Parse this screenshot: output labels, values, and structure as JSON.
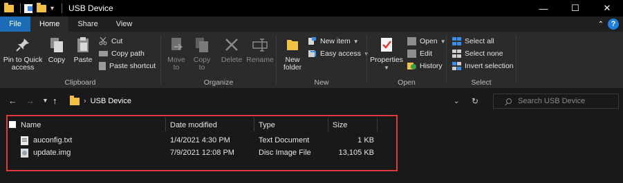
{
  "window": {
    "title": "USB Device",
    "minimize_glyph": "—",
    "maximize_glyph": "☐",
    "close_glyph": "✕"
  },
  "ribbon_tabs": {
    "file": "File",
    "home": "Home",
    "share": "Share",
    "view": "View"
  },
  "clipboard": {
    "pin": "Pin to Quick access",
    "copy": "Copy",
    "paste": "Paste",
    "cut": "Cut",
    "copy_path": "Copy path",
    "paste_shortcut": "Paste shortcut",
    "label": "Clipboard"
  },
  "organize": {
    "move_to": "Move to",
    "copy_to": "Copy to",
    "delete": "Delete",
    "rename": "Rename",
    "label": "Organize"
  },
  "new_group": {
    "new_folder": "New folder",
    "new_item": "New item",
    "easy_access": "Easy access",
    "label": "New"
  },
  "open_group": {
    "properties": "Properties",
    "open": "Open",
    "edit": "Edit",
    "history": "History",
    "label": "Open"
  },
  "select_group": {
    "select_all": "Select all",
    "select_none": "Select none",
    "invert": "Invert selection",
    "label": "Select"
  },
  "address": {
    "path": "USB Device",
    "search_placeholder": "Search USB Device"
  },
  "table": {
    "columns": [
      "Name",
      "Date modified",
      "Type",
      "Size"
    ],
    "rows": [
      {
        "name": "auconfig.txt",
        "date": "1/4/2021 4:30 PM",
        "type": "Text Document",
        "size": "1 KB",
        "icon": "text-file-icon"
      },
      {
        "name": "update.img",
        "date": "7/9/2021 12:08 PM",
        "type": "Disc Image File",
        "size": "13,105 KB",
        "icon": "disc-image-icon"
      }
    ]
  },
  "colors": {
    "accent": "#1c6bb5",
    "highlight_border": "#e23b3b",
    "folder": "#f4c042"
  }
}
